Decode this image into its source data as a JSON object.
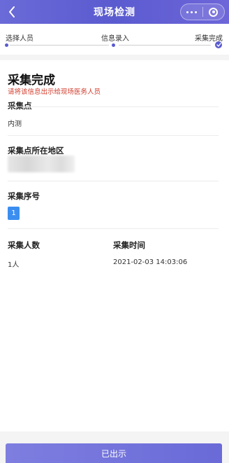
{
  "header": {
    "title": "现场检测"
  },
  "steps": [
    {
      "label": "选择人员"
    },
    {
      "label": "信息录入"
    },
    {
      "label": "采集完成"
    }
  ],
  "card": {
    "title": "采集完成",
    "notice": "请将该信息出示给现场医务人员",
    "site_label": "采集点",
    "site_value": "内测",
    "region_label": "采集点所在地区",
    "seq_label": "采集序号",
    "seq_value": "1",
    "count_label": "采集人数",
    "count_value": "1人",
    "time_label": "采集时间",
    "time_value": "2021-02-03 14:03:06"
  },
  "bottom_button": {
    "label": "已出示"
  },
  "colors": {
    "accent": "#5a5ad0",
    "notice_red": "#d23a2a",
    "badge_blue": "#3b8ef0"
  }
}
